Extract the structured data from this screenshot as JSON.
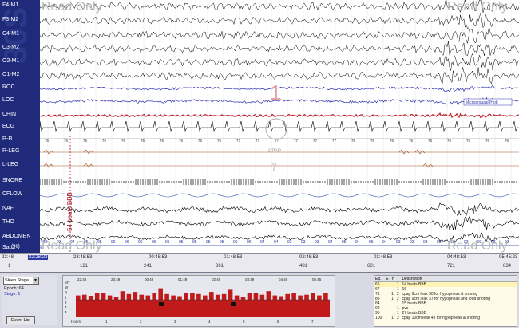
{
  "watermark": {
    "read_only": "Read Only",
    "view_span": "30S"
  },
  "channels": [
    "F4-M1",
    "F3-M2",
    "C4-M1",
    "C3-M2",
    "O2-M1",
    "O1-M2",
    "ROC",
    "LOC",
    "CHIN",
    "ECG",
    "R-R",
    "R-LEG",
    "L-LEG",
    "SNORE",
    "CFLOW",
    "NAF",
    "THO",
    "ABDOMEN",
    "Sao2"
  ],
  "sao2_unit": "(%)",
  "annotations": {
    "beats": "54 beats BBB",
    "microarousal": "Microarousal [Hot]",
    "cpap": "CPAP",
    "cpap_level": "7",
    "big_number": "1"
  },
  "sao2_values": [
    "93",
    "93",
    "94",
    "95",
    "95",
    "96",
    "96",
    "96",
    "96",
    "95",
    "95",
    "95",
    "95",
    "95",
    "96",
    "96",
    "94",
    "94",
    "93",
    "93",
    "93",
    "94",
    "95",
    "94",
    "95",
    "94",
    "93",
    "93",
    "93",
    "93",
    "93",
    "93",
    "93",
    "93",
    "93"
  ],
  "sao2_scale": [
    "100",
    "90"
  ],
  "rr_values": [
    "76",
    "76",
    "76",
    "76",
    "76",
    "76",
    "76",
    "76",
    "76",
    "76",
    "77",
    "77",
    "77",
    "77",
    "77",
    "77",
    "76",
    "76",
    "76",
    "76",
    "76",
    "76",
    "76",
    "76",
    "76"
  ],
  "timeline": {
    "ticks_top": [
      "22:48",
      "22:28:23",
      "23:48:53",
      "00:48:53",
      "01:48:53",
      "02:48:53",
      "03:48:53",
      "04:48:53",
      "05:45:23"
    ],
    "epochs": [
      "1",
      "121",
      "241",
      "361",
      "481",
      "601",
      "721",
      "834"
    ]
  },
  "panel": {
    "sleep_stage_select": "Sleep Stage",
    "epoch_label": "Epoch: 64",
    "stage_label": "Stage: 1",
    "event_list_button": "Event List",
    "hypno_labels": [
      "MT",
      "W",
      "R",
      "1",
      "2",
      "3",
      "4"
    ],
    "hypno_times": [
      "22:48",
      "23:49",
      "00:49",
      "01:49",
      "02:49",
      "03:49",
      "04:49",
      "05:45"
    ],
    "hypno_hours": [
      "Hours",
      "1",
      "2",
      "3",
      "4",
      "5",
      "6",
      "7"
    ],
    "hypno_data": [
      0.3,
      0.35,
      0.28,
      0.5,
      0.45,
      0.3,
      0.2,
      0.6,
      0.4,
      0.55,
      0.35,
      0.3,
      0.5,
      0.8,
      0.4,
      0.3,
      0.25,
      0.45,
      0.5,
      0.4,
      0.3,
      0.55,
      0.35,
      0.4,
      0.7,
      0.3,
      0.2,
      0.5,
      0.45,
      0.35,
      0.6,
      0.3,
      0.25,
      0.4,
      0.5,
      0.3,
      0.35,
      0.45,
      0.3,
      0.5
    ]
  },
  "events": {
    "headers": [
      "Ep.",
      "E",
      "Y",
      "T",
      "Description"
    ],
    "rows": [
      [
        "65",
        "",
        "",
        "1",
        "14 beats BBB"
      ],
      [
        "67",
        "",
        "",
        "1",
        "16"
      ],
      [
        "71",
        "",
        "1",
        "2",
        "cpap 9cm leak 30 for hypopneas & snoring"
      ],
      [
        "83",
        "",
        "1",
        "2",
        "cpap 9cm leak 37 for hypopneas and loud snoring"
      ],
      [
        "84",
        "",
        "",
        "1",
        "15 beats BBB"
      ],
      [
        "92",
        "",
        "",
        "1",
        "pvc"
      ],
      [
        "95",
        "",
        "",
        "1",
        "27 beats BBB"
      ],
      [
        "100",
        "",
        "1",
        "2",
        "cpap 10cm leak 43 for hypopneas & snoring"
      ]
    ]
  },
  "colors": {
    "label_bar": "#1f2b7a",
    "eeg": "#000000",
    "eog": "#2222aa",
    "chin": "#c0202a",
    "hypno_fill": "#c01a1a",
    "cflow": "#2a7a2a"
  }
}
